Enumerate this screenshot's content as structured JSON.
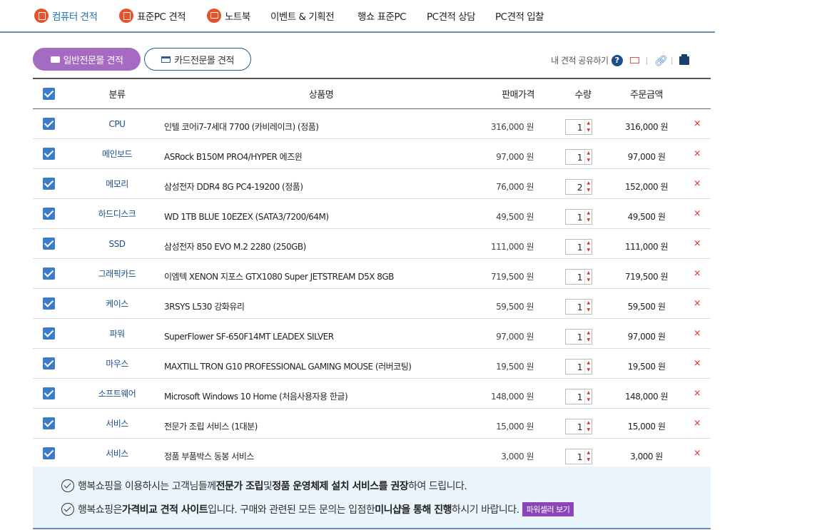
{
  "nav": [
    {
      "label": "컴퓨터 견적",
      "icon": "calculator-icon",
      "active": true
    },
    {
      "label": "표준PC 견적",
      "icon": "pc-tower-icon",
      "active": false
    },
    {
      "label": "노트북",
      "icon": "laptop-icon",
      "active": false
    },
    {
      "label": "이벤트 & 기획전",
      "active": false
    },
    {
      "label": "행쇼 표준PC",
      "active": false
    },
    {
      "label": "PC견적 상담",
      "active": false
    },
    {
      "label": "PC견적 입찰",
      "active": false
    }
  ],
  "modes": {
    "general": "일반전문몰 견적",
    "card": "카드전문몰 견적"
  },
  "share": {
    "label": "내 견적 공유하기",
    "help": "?"
  },
  "table": {
    "headers": {
      "category": "분류",
      "product": "상품명",
      "price": "판매가격",
      "qty": "수량",
      "total": "주문금액"
    },
    "rows": [
      {
        "category": "CPU",
        "product": "인텔 코어i7-7세대 7700 (카비레이크) (정품)",
        "price": "316,000 원",
        "qty": "1",
        "total": "316,000 원"
      },
      {
        "category": "메인보드",
        "product": "ASRock B150M PRO4/HYPER 에즈윈",
        "price": "97,000 원",
        "qty": "1",
        "total": "97,000 원"
      },
      {
        "category": "메모리",
        "product": "삼성전자 DDR4 8G PC4-19200 (정품)",
        "price": "76,000 원",
        "qty": "2",
        "total": "152,000 원"
      },
      {
        "category": "하드디스크",
        "product": "WD 1TB BLUE 10EZEX (SATA3/7200/64M)",
        "price": "49,500 원",
        "qty": "1",
        "total": "49,500 원"
      },
      {
        "category": "SSD",
        "product": "삼성전자 850 EVO M.2 2280 (250GB)",
        "price": "111,000 원",
        "qty": "1",
        "total": "111,000 원"
      },
      {
        "category": "그래픽카드",
        "product": "이엠텍 XENON 지포스 GTX1080 Super JETSTREAM D5X 8GB",
        "price": "719,500 원",
        "qty": "1",
        "total": "719,500 원"
      },
      {
        "category": "케이스",
        "product": "3RSYS L530 강화유리",
        "price": "59,500 원",
        "qty": "1",
        "total": "59,500 원"
      },
      {
        "category": "파워",
        "product": "SuperFlower SF-650F14MT LEADEX SILVER",
        "price": "97,000 원",
        "qty": "1",
        "total": "97,000 원"
      },
      {
        "category": "마우스",
        "product": "MAXTILL TRON G10 PROFESSIONAL GAMING MOUSE (러버코팅)",
        "price": "19,500 원",
        "qty": "1",
        "total": "19,500 원"
      },
      {
        "category": "소프트웨어",
        "product": "Microsoft Windows 10 Home (처음사용자용 한글)",
        "price": "148,000 원",
        "qty": "1",
        "total": "148,000 원"
      },
      {
        "category": "서비스",
        "product": "전문가 조립 서비스 (1대분)",
        "price": "15,000 원",
        "qty": "1",
        "total": "15,000 원"
      },
      {
        "category": "서비스",
        "product": "정품 부품박스 동봉 서비스",
        "price": "3,000 원",
        "qty": "1",
        "total": "3,000 원"
      }
    ],
    "delete_symbol": "×"
  },
  "notice": {
    "line1": {
      "a": "행복쇼핑을 이용하시는 고객님들께 ",
      "b": "전문가 조립",
      "c": " 및 ",
      "d": "정품 운영체제 설치 서비스를 권장",
      "e": "하여 드립니다."
    },
    "line2": {
      "a": "행복쇼핑은 ",
      "b": "가격비교 견적 사이트",
      "c": "입니다. 구매와 관련된 모든 문의는 입점한 ",
      "d": "미니샵을 통해 진행",
      "e": "하시기 바랍니다.",
      "button": "파워셀러 보기"
    }
  },
  "colors": {
    "accent": "#1c6fb0",
    "nav_icon": "#e7512c",
    "mode_active": "#a56ac2",
    "checkbox": "#3b7cc9",
    "delete": "#d7342c",
    "seller_button": "#8a46b6",
    "notice_bg": "#e9f4fb"
  }
}
